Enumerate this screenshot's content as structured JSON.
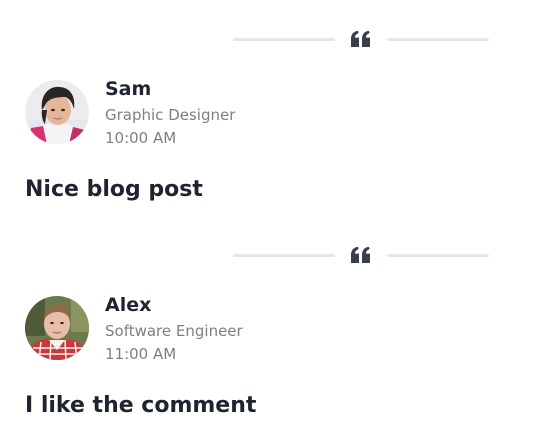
{
  "comments": [
    {
      "avatar_icon": "avatar-sam",
      "name": "Sam",
      "role": "Graphic Designer",
      "time": "10:00 AM",
      "text": "Nice blog post"
    },
    {
      "avatar_icon": "avatar-alex",
      "name": "Alex",
      "role": "Software Engineer",
      "time": "11:00 AM",
      "text": "I like the comment"
    }
  ],
  "colors": {
    "text_primary": "#1f2430",
    "text_muted": "#7b8088",
    "divider_line": "#e7e7e9",
    "quote_mark": "#3a3f4b"
  },
  "divider_icon": "quote-icon"
}
